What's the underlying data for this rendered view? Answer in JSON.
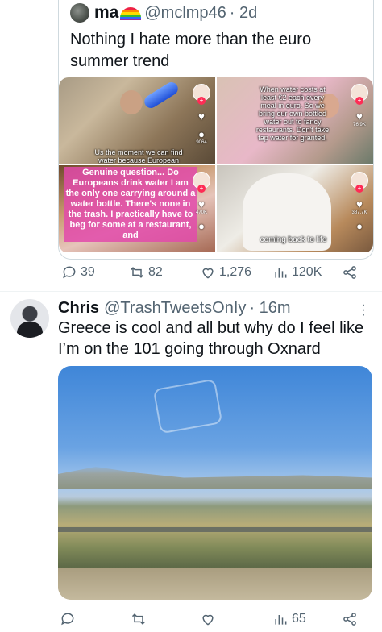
{
  "quoted": {
    "name": "ma",
    "name_emoji": "rainbow",
    "handle": "@mclmp46",
    "time": "· 2d",
    "text": "Nothing I hate more than the euro summer trend",
    "tiles": [
      {
        "caption": "Us the moment we can find water because European",
        "count": "9064"
      },
      {
        "caption": "When water costs at least €2 each every meal in euro. So we bring our own bottled water out to fancy restaurants. Don't take tap water for granted.",
        "count": "76.9K"
      },
      {
        "caption": "Genuine question... Do Europeans drink water I am the only one carrying around a water bottle. There's none in the trash. I practically have to beg for some at a restaurant, and",
        "count": "470K"
      },
      {
        "caption": "coming back to life",
        "count": "387.7K"
      }
    ],
    "stats": {
      "replies": "39",
      "reposts": "82",
      "likes": "1,276",
      "views": "120K"
    }
  },
  "tweet": {
    "name": "Chris",
    "handle": "@TrashTweetsOnIy",
    "time": "· 16m",
    "text": "Greece is cool and all but why do I feel like I’m on the 101 going through Oxnard",
    "stats": {
      "views": "65"
    }
  },
  "icons": [
    "reply-icon",
    "repost-icon",
    "like-icon",
    "views-icon",
    "share-icon",
    "more-icon"
  ],
  "colors": {
    "text": "#0f1419",
    "secondary": "#536471",
    "border": "#cfd9de",
    "tiktok_pink": "#fe2c55"
  }
}
